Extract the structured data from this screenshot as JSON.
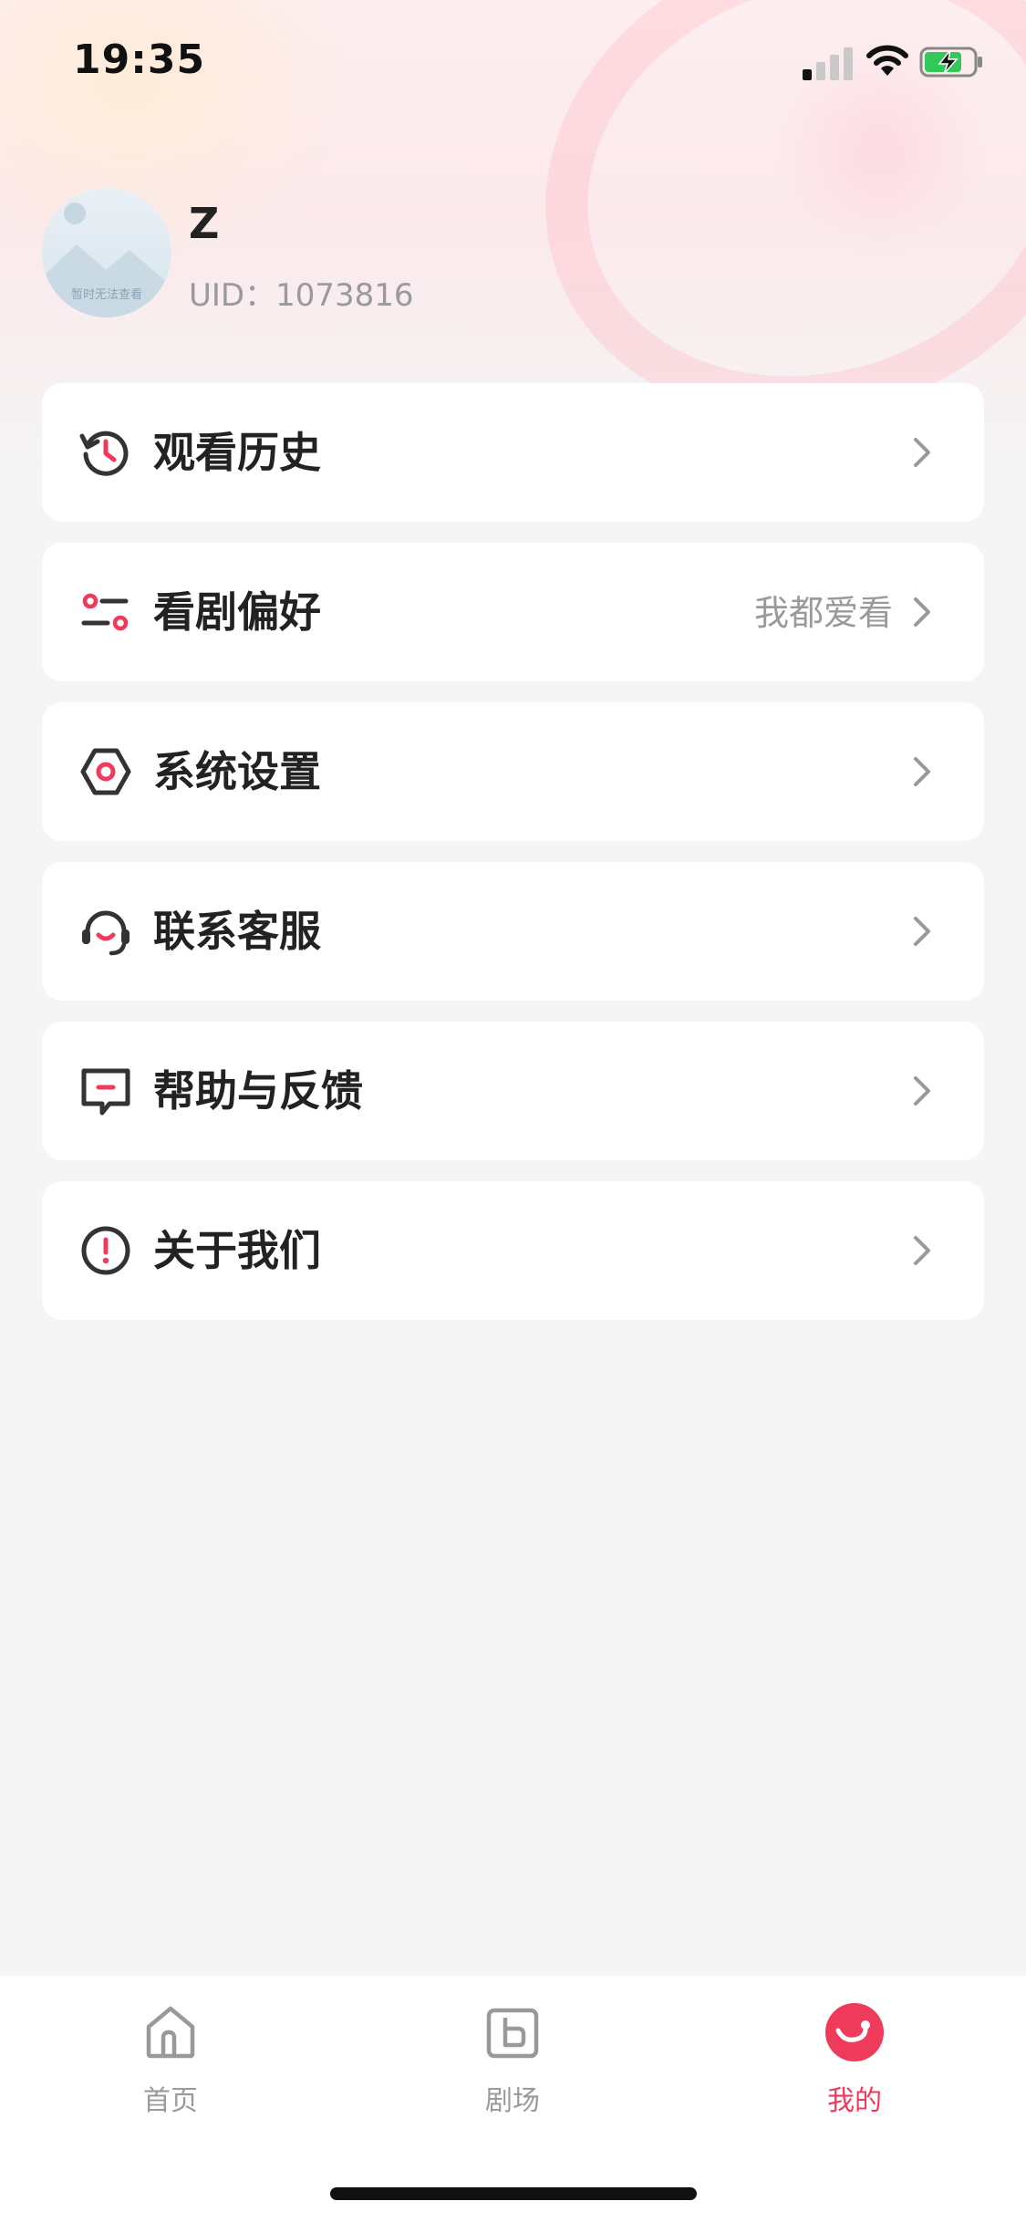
{
  "status_bar": {
    "time": "19:35"
  },
  "profile": {
    "name": "Z",
    "uid_text": "UID：1073816",
    "avatar_caption": "暂时无法查看"
  },
  "menu": {
    "items": [
      {
        "label": "观看历史",
        "value": ""
      },
      {
        "label": "看剧偏好",
        "value": "我都爱看"
      },
      {
        "label": "系统设置",
        "value": ""
      },
      {
        "label": "联系客服",
        "value": ""
      },
      {
        "label": "帮助与反馈",
        "value": ""
      },
      {
        "label": "关于我们",
        "value": ""
      }
    ]
  },
  "tabbar": {
    "tabs": [
      {
        "label": "首页",
        "active": false
      },
      {
        "label": "剧场",
        "active": false
      },
      {
        "label": "我的",
        "active": true
      }
    ]
  },
  "colors": {
    "accent": "#ef3b5b",
    "text": "#222222",
    "muted": "#9a9a9a",
    "background": "#f5f5f5"
  }
}
